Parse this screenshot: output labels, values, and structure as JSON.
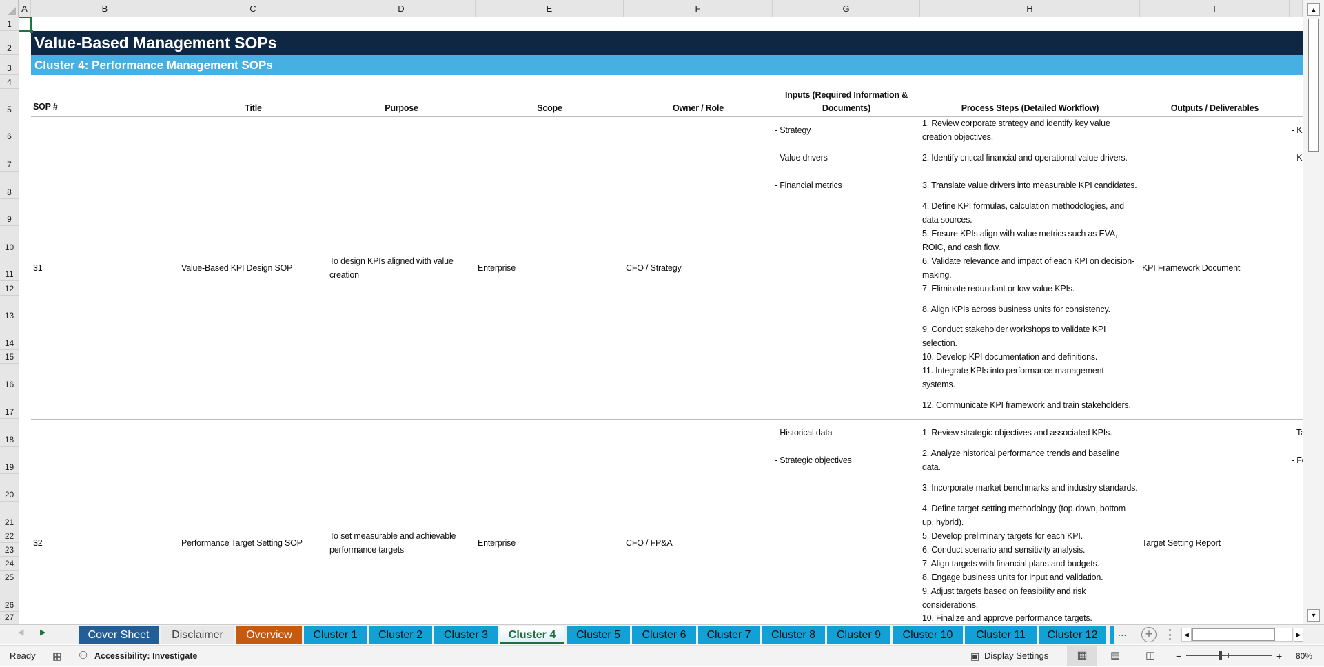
{
  "columns": [
    "A",
    "B",
    "C",
    "D",
    "E",
    "F",
    "G",
    "H",
    "I"
  ],
  "rows": [
    "1",
    "2",
    "3",
    "4",
    "5",
    "6",
    "7",
    "8",
    "9",
    "10",
    "11",
    "12",
    "13",
    "14",
    "15",
    "16",
    "17",
    "18",
    "19",
    "20",
    "21",
    "22",
    "23",
    "24",
    "25",
    "26",
    "27"
  ],
  "sheet": {
    "title": "Value-Based Management SOPs",
    "subtitle": "Cluster 4: Performance Management SOPs",
    "headers": {
      "sop": "SOP #",
      "title": "Title",
      "purpose": "Purpose",
      "scope": "Scope",
      "owner": "Owner / Role",
      "inputs": "Inputs (Required Information & Documents)",
      "steps": "Process Steps (Detailed Workflow)",
      "outputs": "Outputs / Deliverables"
    },
    "sops": [
      {
        "number": "31",
        "title": "Value-Based KPI Design SOP",
        "purpose": "To design KPIs aligned with value creation",
        "scope": "Enterprise",
        "owner": "CFO / Strategy",
        "inputs": [
          "- Strategy",
          "- Value drivers",
          "- Financial metrics"
        ],
        "steps": [
          "1. Review corporate strategy and identify key value creation objectives.",
          "2. Identify critical financial and operational value drivers.",
          "3. Translate value drivers into measurable KPI candidates.",
          "4. Define KPI formulas, calculation methodologies, and data sources.",
          "5. Ensure KPIs align with value metrics such as EVA, ROIC, and cash flow.",
          "6. Validate relevance and impact of each KPI on decision-making.",
          "7. Eliminate redundant or low-value KPIs.",
          "8. Align KPIs across business units for consistency.",
          "9. Conduct stakeholder workshops to validate KPI selection.",
          "10. Develop KPI documentation and definitions.",
          "11. Integrate KPIs into performance management systems.",
          "12. Communicate KPI framework and train stakeholders."
        ],
        "outputs": "KPI Framework Document",
        "next_col": [
          "- KP",
          "- KP"
        ]
      },
      {
        "number": "32",
        "title": "Performance Target Setting SOP",
        "purpose": "To set measurable and achievable performance targets",
        "scope": "Enterprise",
        "owner": "CFO / FP&A",
        "inputs": [
          "- Historical data",
          "- Strategic objectives"
        ],
        "steps": [
          "1. Review strategic objectives and associated KPIs.",
          "2. Analyze historical performance trends and baseline data.",
          "3. Incorporate market benchmarks and industry standards.",
          "4. Define target-setting methodology (top-down, bottom-up, hybrid).",
          "5. Develop preliminary targets for each KPI.",
          "6. Conduct scenario and sensitivity analysis.",
          "7. Align targets with financial plans and budgets.",
          "8. Engage business units for input and validation.",
          "9. Adjust targets based on feasibility and risk considerations.",
          "10. Finalize and approve performance targets."
        ],
        "outputs": "Target Setting Report",
        "next_col": [
          "- Ta",
          "- Fo"
        ]
      }
    ]
  },
  "tabs": [
    {
      "label": "Cover Sheet",
      "bg": "#215f9a",
      "fg": "#ffffff"
    },
    {
      "label": "Disclaimer",
      "bg": "#e8e8e8",
      "fg": "#444444"
    },
    {
      "label": "Overview",
      "bg": "#c55a11",
      "fg": "#ffffff"
    },
    {
      "label": "Cluster 1",
      "bg": "#12a0d7",
      "fg": "#111111"
    },
    {
      "label": "Cluster 2",
      "bg": "#12a0d7",
      "fg": "#111111"
    },
    {
      "label": "Cluster 3",
      "bg": "#12a0d7",
      "fg": "#111111"
    },
    {
      "label": "Cluster 4",
      "bg": "#ffffff",
      "fg": "#1e6e3e",
      "active": true
    },
    {
      "label": "Cluster 5",
      "bg": "#12a0d7",
      "fg": "#111111"
    },
    {
      "label": "Cluster 6",
      "bg": "#12a0d7",
      "fg": "#111111"
    },
    {
      "label": "Cluster 7",
      "bg": "#12a0d7",
      "fg": "#111111"
    },
    {
      "label": "Cluster 8",
      "bg": "#12a0d7",
      "fg": "#111111"
    },
    {
      "label": "Cluster 9",
      "bg": "#12a0d7",
      "fg": "#111111"
    },
    {
      "label": "Cluster 10",
      "bg": "#12a0d7",
      "fg": "#111111"
    },
    {
      "label": "Cluster 11",
      "bg": "#12a0d7",
      "fg": "#111111"
    },
    {
      "label": "Cluster 12",
      "bg": "#12a0d7",
      "fg": "#111111"
    }
  ],
  "tabbar": {
    "more": "...",
    "add": "+"
  },
  "status": {
    "ready": "Ready",
    "accessibility": "Accessibility: Investigate",
    "display_settings": "Display Settings",
    "zoom_minus": "−",
    "zoom_plus": "+",
    "zoom": "80%",
    "zoom_value": 80
  },
  "colors": {
    "title_bg": "#0f2742",
    "subtitle_bg": "#45b0e1",
    "selection": "#217346"
  }
}
